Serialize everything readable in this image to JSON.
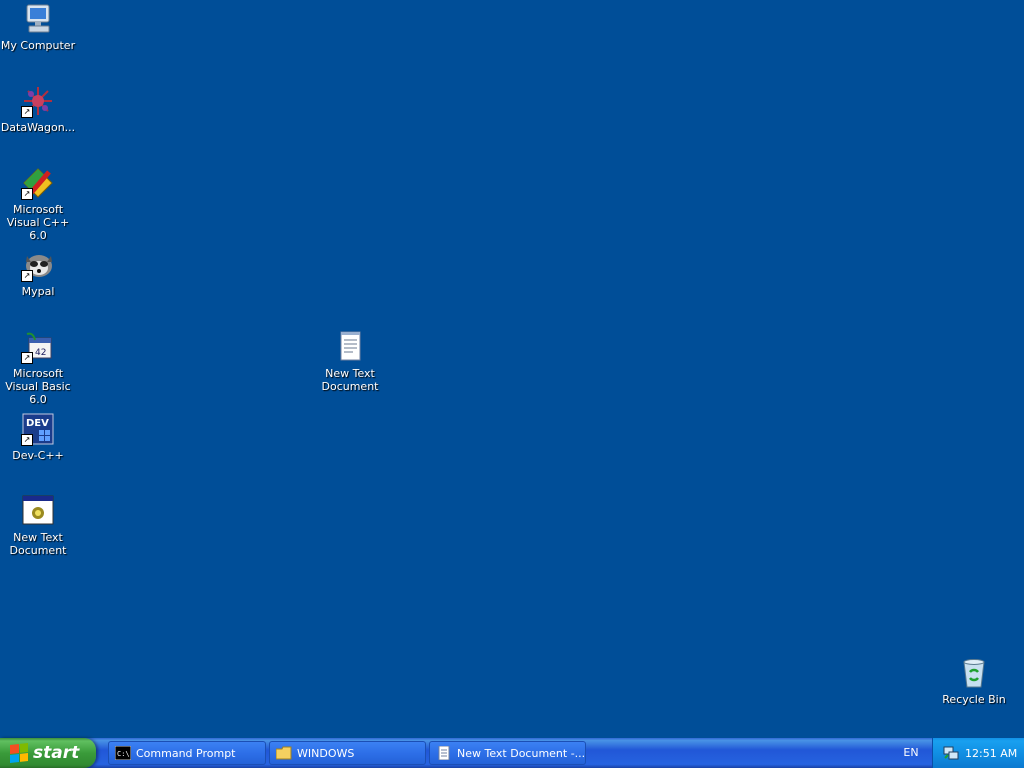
{
  "desktop": {
    "background_color": "#004e98",
    "icons": [
      {
        "label": "My Computer",
        "icon": "my-computer-icon"
      },
      {
        "label": "DataWagon...",
        "icon": "datawagon-icon"
      },
      {
        "label": "Microsoft Visual C++ 6.0",
        "icon": "visual-cpp-icon"
      },
      {
        "label": "Mypal",
        "icon": "mypal-icon"
      },
      {
        "label": "Microsoft Visual Basic 6.0",
        "icon": "visual-basic-icon"
      },
      {
        "label": "Dev-C++",
        "icon": "dev-cpp-icon"
      },
      {
        "label": "New Text Document",
        "icon": "program-window-icon"
      },
      {
        "label": "New Text Document",
        "icon": "text-document-icon"
      },
      {
        "label": "Recycle Bin",
        "icon": "recycle-bin-icon"
      }
    ]
  },
  "taskbar": {
    "start_label": "start",
    "tasks": [
      {
        "label": "Command Prompt",
        "icon": "command-prompt-icon"
      },
      {
        "label": "WINDOWS",
        "icon": "folder-icon"
      },
      {
        "label": "New Text Document -...",
        "icon": "notepad-icon"
      }
    ],
    "language": "EN",
    "clock": "12:51 AM"
  },
  "colors": {
    "desktop": "#004e98",
    "taskbar": "#2157d7",
    "start_button": "#3a9b3a",
    "tray": "#0f8be0"
  }
}
